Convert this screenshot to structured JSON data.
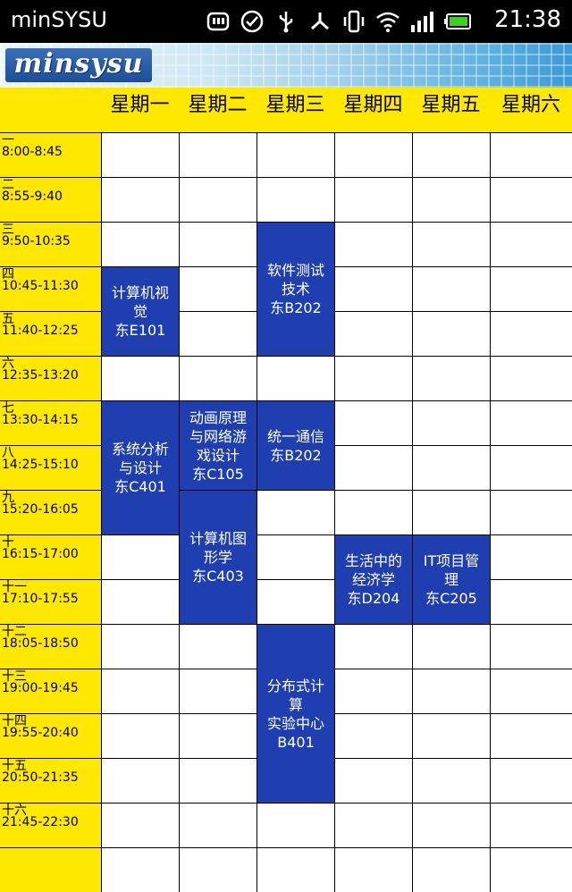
{
  "status_bar": {
    "app_title": "minSYSU",
    "time": "21:38",
    "icons": [
      "message-icon",
      "check-circle-icon",
      "usb-icon",
      "share-icon",
      "vibrate-icon",
      "wifi-icon",
      "signal-icon",
      "battery-icon"
    ]
  },
  "header": {
    "logo_text": "minsysu"
  },
  "days": [
    "星期一",
    "星期二",
    "星期三",
    "星期四",
    "星期五",
    "星期六"
  ],
  "periods": [
    {
      "num": "一",
      "time": "8:00-8:45"
    },
    {
      "num": "二",
      "time": "8:55-9:40"
    },
    {
      "num": "三",
      "time": "9:50-10:35"
    },
    {
      "num": "四",
      "time": "10:45-11:30"
    },
    {
      "num": "五",
      "time": "11:40-12:25"
    },
    {
      "num": "六",
      "time": "12:35-13:20"
    },
    {
      "num": "七",
      "time": "13:30-14:15"
    },
    {
      "num": "八",
      "time": "14:25-15:10"
    },
    {
      "num": "九",
      "time": "15:20-16:05"
    },
    {
      "num": "十",
      "time": "16:15-17:00"
    },
    {
      "num": "十一",
      "time": "17:10-17:55"
    },
    {
      "num": "十二",
      "time": "18:05-18:50"
    },
    {
      "num": "十三",
      "time": "19:00-19:45"
    },
    {
      "num": "十四",
      "time": "19:55-20:40"
    },
    {
      "num": "十五",
      "time": "20:50-21:35"
    },
    {
      "num": "十六",
      "time": "21:45-22:30"
    }
  ],
  "courses": [
    {
      "day": 0,
      "start": 3,
      "span": 2,
      "lines": [
        "计算机视",
        "觉",
        "东E101"
      ]
    },
    {
      "day": 2,
      "start": 2,
      "span": 3,
      "lines": [
        "软件测试",
        "技术",
        "东B202"
      ]
    },
    {
      "day": 0,
      "start": 6,
      "span": 3,
      "lines": [
        "系统分析",
        "与设计",
        "东C401"
      ]
    },
    {
      "day": 1,
      "start": 6,
      "span": 2,
      "lines": [
        "动画原理",
        "与网络游",
        "戏设计",
        "东C105"
      ]
    },
    {
      "day": 2,
      "start": 6,
      "span": 2,
      "lines": [
        "统一通信",
        "东B202"
      ]
    },
    {
      "day": 1,
      "start": 8,
      "span": 3,
      "lines": [
        "计算机图",
        "形学",
        "东C403"
      ]
    },
    {
      "day": 3,
      "start": 9,
      "span": 2,
      "lines": [
        "生活中的",
        "经济学",
        "东D204"
      ]
    },
    {
      "day": 4,
      "start": 9,
      "span": 2,
      "lines": [
        "IT项目管",
        "理",
        "东C205"
      ]
    },
    {
      "day": 2,
      "start": 11,
      "span": 4,
      "lines": [
        "分布式计",
        "算",
        "实验中心",
        "B401"
      ]
    }
  ],
  "colors": {
    "header_yellow": "#ffe800",
    "course_blue": "#1f3fb0",
    "status_bg": "#000000"
  }
}
